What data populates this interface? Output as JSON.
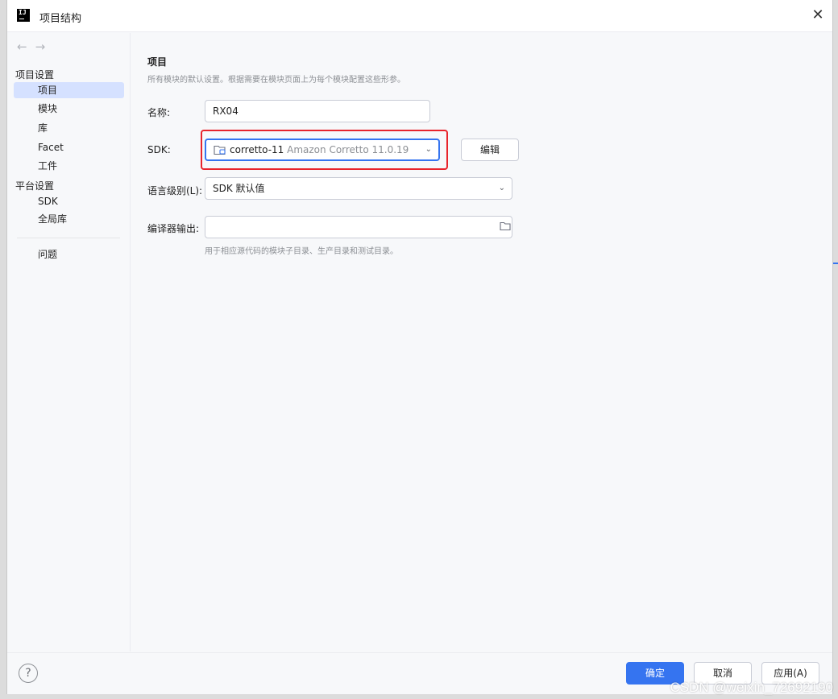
{
  "window": {
    "title": "项目结构",
    "app_icon_text": "IJ"
  },
  "sidebar": {
    "back_glyph": "←",
    "forward_glyph": "→",
    "section_project": "项目设置",
    "items_project": [
      {
        "label": "项目",
        "selected": true
      },
      {
        "label": "模块"
      },
      {
        "label": "库"
      },
      {
        "label": "Facet"
      },
      {
        "label": "工件"
      }
    ],
    "section_platform": "平台设置",
    "items_platform": [
      {
        "label": "SDK"
      },
      {
        "label": "全局库"
      }
    ],
    "problems": "问题"
  },
  "main": {
    "heading": "项目",
    "description": "所有模块的默认设置。根据需要在模块页面上为每个模块配置这些形参。",
    "name_label": "名称:",
    "name_value": "RX04",
    "sdk_label": "SDK:",
    "sdk_name": "corretto-11",
    "sdk_detail": "Amazon Corretto 11.0.19",
    "edit_button": "编辑",
    "lang_label": "语言级别(L):",
    "lang_value": "SDK 默认值",
    "compiler_label": "编译器输出:",
    "compiler_value": "",
    "compiler_hint": "用于相应源代码的模块子目录、生产目录和测试目录。"
  },
  "footer": {
    "help": "?",
    "ok": "确定",
    "cancel": "取消",
    "apply": "应用(A)"
  },
  "watermark": "CSDN @weixin_72692190",
  "colors": {
    "accent": "#3574f0",
    "highlight": "#e8242c",
    "selected_bg": "#d5e1ff"
  }
}
